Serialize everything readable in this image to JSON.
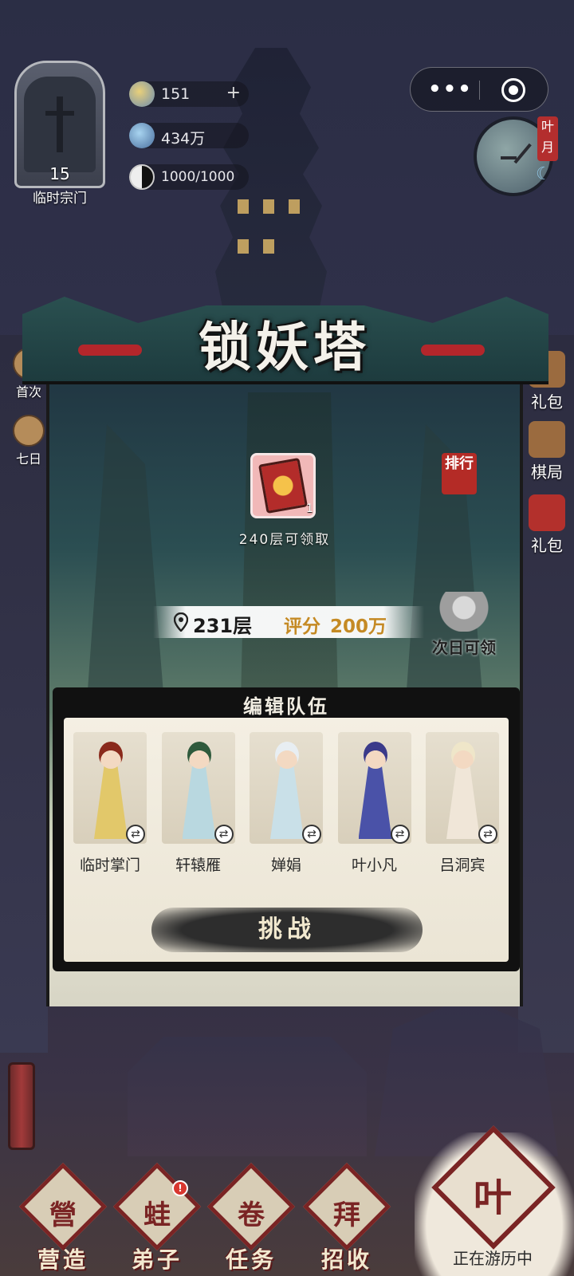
{
  "sect": {
    "level": "15",
    "name": "临时宗门"
  },
  "resources": [
    {
      "icon": "spirit-stone-icon",
      "value": "151",
      "plus": "+"
    },
    {
      "icon": "crystal-icon",
      "value": "434万"
    },
    {
      "icon": "yin-yang-icon",
      "value": "1000/1000"
    }
  ],
  "clock": {
    "tag": "叶月"
  },
  "side_left": [
    "首次",
    "七日"
  ],
  "side_right": [
    "礼包",
    "棋局",
    "礼包"
  ],
  "tower": {
    "title": "锁妖塔",
    "rank_label": "排行",
    "reward_count": "1",
    "reward_text": "240层可领取",
    "floor": "231层",
    "score_label": "评分",
    "score_value": "200万",
    "daily_label": "次日可领"
  },
  "team": {
    "title": "编辑队伍",
    "heroes": [
      {
        "name": "临时掌门",
        "hair": "#8a2a1c",
        "robe": "#e2c86a"
      },
      {
        "name": "轩辕雁",
        "hair": "#2f5a3c",
        "robe": "#b9d8e0"
      },
      {
        "name": "婵娟",
        "hair": "#e8eef2",
        "robe": "#c9e0e8"
      },
      {
        "name": "叶小凡",
        "hair": "#3a3a8a",
        "robe": "#4a52a8"
      },
      {
        "name": "吕洞宾",
        "hair": "#efe6c9",
        "robe": "#f0e6d8"
      }
    ],
    "challenge_label": "挑战"
  },
  "nav": {
    "items": [
      {
        "label": "营造",
        "glyph": "營"
      },
      {
        "label": "弟子",
        "glyph": "蛙",
        "badge": "!"
      },
      {
        "label": "任务",
        "glyph": "卷"
      },
      {
        "label": "招收",
        "glyph": "拜"
      }
    ],
    "travel_label": "正在游历中",
    "travel_glyph": "叶"
  },
  "colors": {
    "accent": "#7a2424",
    "score": "#c58a24",
    "seal": "#b42b26"
  }
}
